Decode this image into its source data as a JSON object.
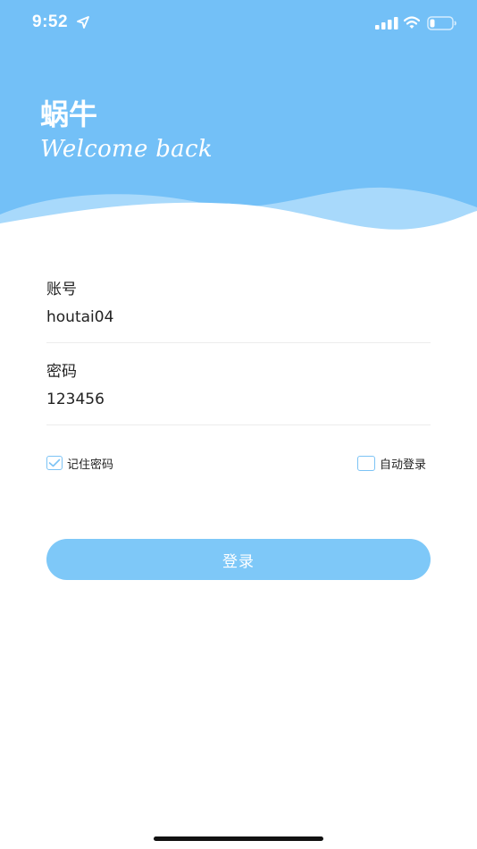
{
  "status_bar": {
    "time": "9:52"
  },
  "brand": {
    "title": "蜗牛",
    "subtitle": "Welcome back"
  },
  "form": {
    "account": {
      "label": "账号",
      "value": "houtai04"
    },
    "password": {
      "label": "密码",
      "value": "123456"
    },
    "remember_password": {
      "label": "记住密码",
      "checked": true
    },
    "auto_login": {
      "label": "自动登录",
      "checked": false
    },
    "submit_label": "登录"
  },
  "colors": {
    "header_blue": "#73c0f7",
    "wave_light": "#a8d9fb",
    "button_blue": "#7ec8f8",
    "checkbox_border": "#7cc3f5"
  },
  "icons": {
    "location": "location-arrow-icon",
    "signal": "cellular-signal-icon",
    "wifi": "wifi-icon",
    "battery": "battery-low-icon",
    "check": "checkmark-icon"
  }
}
